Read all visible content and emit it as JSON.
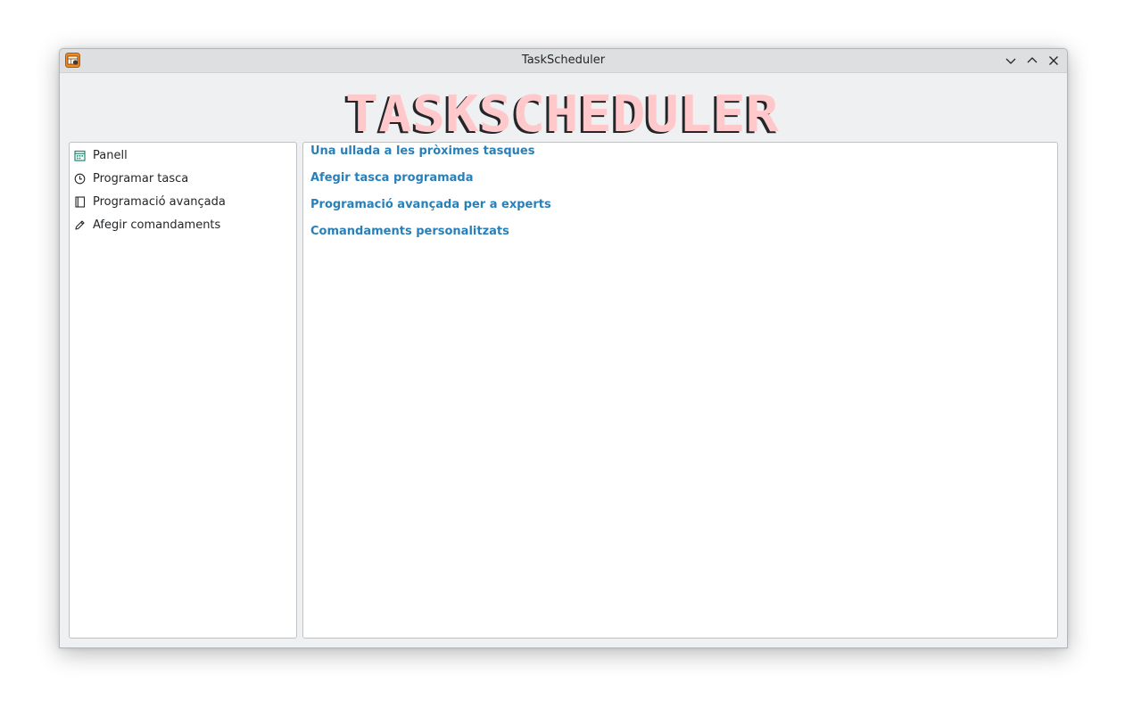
{
  "window": {
    "title": "TaskScheduler"
  },
  "header": {
    "logo_text": "TASKSCHEDULER"
  },
  "sidebar": {
    "items": [
      {
        "label": "Panell",
        "icon": "calendar-icon"
      },
      {
        "label": "Programar tasca",
        "icon": "clock-icon"
      },
      {
        "label": "Programació avançada",
        "icon": "notebook-icon"
      },
      {
        "label": "Afegir comandaments",
        "icon": "pencil-icon"
      }
    ]
  },
  "main": {
    "links": [
      "Una ullada a les pròximes tasques",
      "Afegir tasca programada",
      "Programació avançada per a experts",
      "Comandaments personalitzats"
    ]
  },
  "colors": {
    "link": "#2980b9",
    "logo_fill": "#ffc9cc",
    "logo_outline": "#232629",
    "calendar_icon": "#1d8a6e",
    "window_bg": "#eff0f1"
  }
}
